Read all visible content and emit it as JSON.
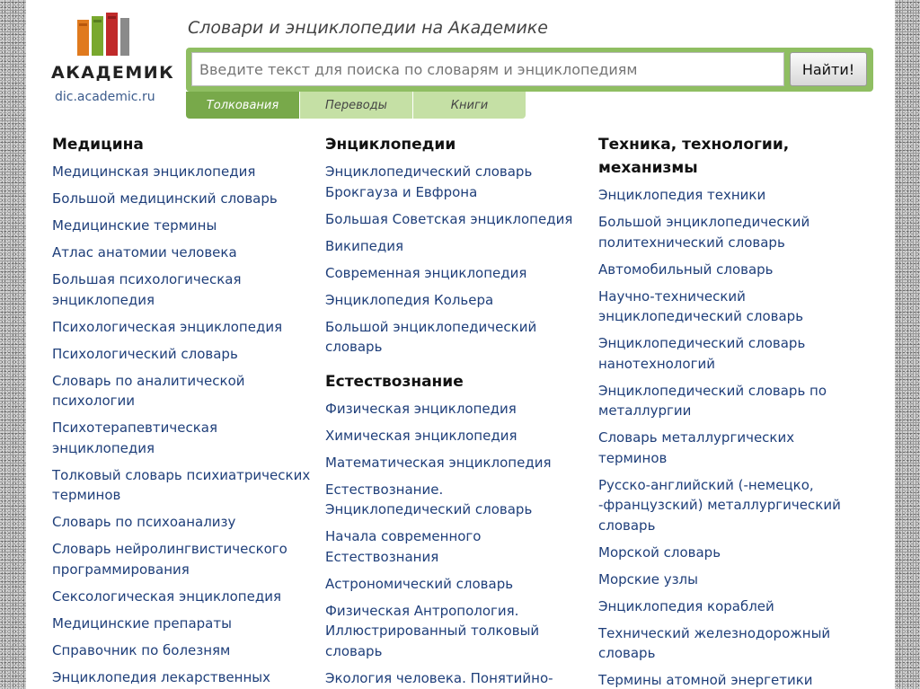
{
  "logo": {
    "word": "АКАДЕМИК",
    "url": "dic.academic.ru"
  },
  "header": {
    "title": "Словари и энциклопедии на Академике"
  },
  "search": {
    "placeholder": "Введите текст для поиска по словарям и энциклопедиям",
    "button": "Найти!"
  },
  "tabs": [
    "Толкования",
    "Переводы",
    "Книги"
  ],
  "colors": {
    "green": "#8fbe62",
    "tab_active": "#78a94a",
    "link": "#1f3f7a"
  },
  "col1": {
    "title": "Медицина",
    "links": [
      "Медицинская энциклопедия",
      "Большой медицинский словарь",
      "Медицинские термины",
      "Атлас анатомии человека",
      "Большая психологическая энциклопедия",
      "Психологическая энциклопедия",
      "Психологический словарь",
      "Словарь по аналитической психологии",
      "Психотерапевтическая энциклопедия",
      "Толковый словарь психиатрических терминов",
      "Словарь по психоанализу",
      "Словарь нейролингвистического программирования",
      "Сексологическая энциклопедия",
      "Медицинские препараты",
      "Справочник по болезням",
      "Энциклопедия лекарственных"
    ]
  },
  "col2": {
    "title": "Энциклопедии",
    "links": [
      "Энциклопедический словарь Брокгауза и Евфрона",
      "Большая Советская энциклопедия",
      "Википедия",
      "Современная энциклопедия",
      "Энциклопедия Кольера",
      "Большой энциклопедический словарь"
    ],
    "title2": "Естествознание",
    "links2": [
      "Физическая энциклопедия",
      "Химическая энциклопедия",
      "Математическая энциклопедия",
      "Естествознание. Энциклопедический словарь",
      "Начала современного Естествознания",
      "Астрономический словарь",
      "Физическая Антропология. Иллюстрированный толковый словарь",
      "Экология человека. Понятийно-"
    ]
  },
  "col3": {
    "title": "Техника, технологии, механизмы",
    "links": [
      "Энциклопедия техники",
      "Большой энциклопедический политехнический словарь",
      "Автомобильный словарь",
      "Научно-технический энциклопедический словарь",
      "Энциклопедический словарь нанотехнологий",
      "Энциклопедический словарь по металлургии",
      "Словарь металлургических терминов",
      "Русско-английский (-немецко, -французский) металлургический словарь",
      "Морской словарь",
      "Морские узлы",
      "Энциклопедия кораблей",
      "Технический железнодорожный словарь",
      "Термины атомной энергетики"
    ]
  }
}
